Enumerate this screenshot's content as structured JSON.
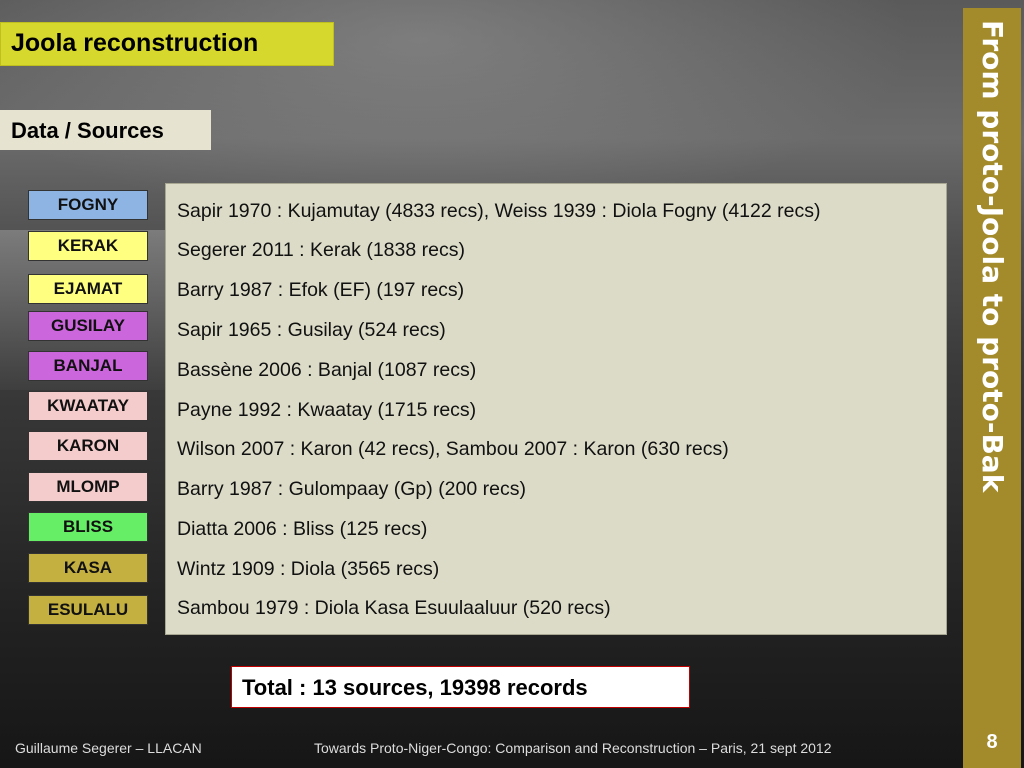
{
  "slide": {
    "title": "Joola reconstruction",
    "subtitle": "Data / Sources",
    "side_title": "From proto-Joola to proto-Bak",
    "page_number": "8",
    "total": "Total : 13 sources, 19398 records"
  },
  "footer": {
    "author": "Guillaume Segerer – LLACAN",
    "event": "Towards Proto-Niger-Congo: Comparison and Reconstruction – Paris, 21 sept 2012"
  },
  "languages": [
    {
      "label": "FOGNY",
      "color": "#8eb4e3"
    },
    {
      "label": "KERAK",
      "color": "#ffff80"
    },
    {
      "label": "EJAMAT",
      "color": "#ffff80"
    },
    {
      "label": "GUSILAY",
      "color": "#cc66dd"
    },
    {
      "label": "BANJAL",
      "color": "#cc66dd"
    },
    {
      "label": "KWAATAY",
      "color": "#f4cccc"
    },
    {
      "label": "KARON",
      "color": "#f4cccc"
    },
    {
      "label": "MLOMP",
      "color": "#f4cccc"
    },
    {
      "label": "BLISS",
      "color": "#66ee66"
    },
    {
      "label": "KASA",
      "color": "#c4b040"
    },
    {
      "label": "ESULALU",
      "color": "#c4b040"
    }
  ],
  "sources": [
    "Sapir 1970 : Kujamutay (4833 recs), Weiss 1939 : Diola Fogny (4122 recs)",
    "Segerer 2011 : Kerak (1838 recs)",
    "Barry 1987 : Efok (EF) (197 recs)",
    "Sapir 1965 : Gusilay (524 recs)",
    "Bassène 2006 : Banjal (1087 recs)",
    "Payne 1992 : Kwaatay (1715 recs)",
    "Wilson 2007 : Karon (42 recs), Sambou 2007 : Karon (630 recs)",
    "Barry 1987 : Gulompaay (Gp) (200 recs)",
    "Diatta 2006 : Bliss (125 recs)",
    "Wintz 1909 : Diola (3565 recs)",
    "Sambou 1979 : Diola Kasa Esuulaaluur (520 recs)"
  ]
}
